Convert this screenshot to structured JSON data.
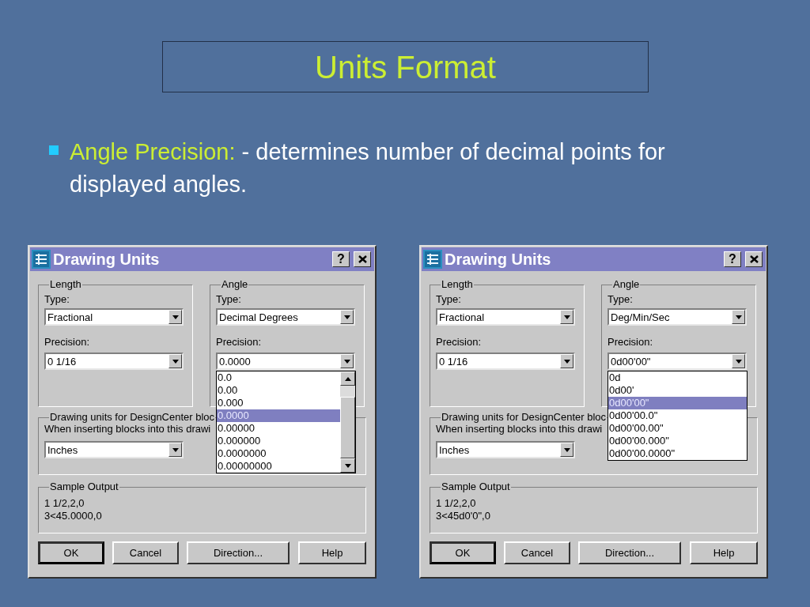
{
  "slide": {
    "title": "Units Format",
    "bullet": {
      "term": "Angle Precision:",
      "text": " - determines number of decimal points for displayed angles."
    }
  },
  "dialogs": [
    {
      "title": "Drawing Units",
      "help_button": "?",
      "length": {
        "label": "Length",
        "type_label": "Type:",
        "type": "Fractional",
        "precision_label": "Precision:",
        "precision": "0 1/16"
      },
      "angle": {
        "label": "Angle",
        "type_label": "Type:",
        "type": "Decimal Degrees",
        "precision_label": "Precision:",
        "precision": "0.0000",
        "dropdown": {
          "scrollbar": true,
          "options": [
            {
              "label": "0.0",
              "selected": false
            },
            {
              "label": "0.00",
              "selected": false
            },
            {
              "label": "0.000",
              "selected": false
            },
            {
              "label": "0.0000",
              "selected": true
            },
            {
              "label": "0.00000",
              "selected": false
            },
            {
              "label": "0.000000",
              "selected": false
            },
            {
              "label": "0.0000000",
              "selected": false
            },
            {
              "label": "0.00000000",
              "selected": false
            }
          ]
        }
      },
      "insert": {
        "label": "Drawing units for DesignCenter bloc",
        "prompt": "When inserting blocks into this drawi",
        "units": "Inches"
      },
      "sample": {
        "label": "Sample Output",
        "lines": [
          "1 1/2,2,0",
          "3<45.0000,0"
        ]
      },
      "buttons": [
        {
          "label": "OK",
          "default": true
        },
        {
          "label": "Cancel",
          "default": false
        },
        {
          "label": "Direction...",
          "default": false
        },
        {
          "label": "Help",
          "default": false
        }
      ]
    },
    {
      "title": "Drawing Units",
      "help_button": "?",
      "length": {
        "label": "Length",
        "type_label": "Type:",
        "type": "Fractional",
        "precision_label": "Precision:",
        "precision": "0 1/16"
      },
      "angle": {
        "label": "Angle",
        "type_label": "Type:",
        "type": "Deg/Min/Sec",
        "precision_label": "Precision:",
        "precision": "0d00'00\"",
        "dropdown": {
          "scrollbar": false,
          "options": [
            {
              "label": "0d",
              "selected": false
            },
            {
              "label": "0d00'",
              "selected": false
            },
            {
              "label": "0d00'00\"",
              "selected": true
            },
            {
              "label": "0d00'00.0\"",
              "selected": false
            },
            {
              "label": "0d00'00.00\"",
              "selected": false
            },
            {
              "label": "0d00'00.000\"",
              "selected": false
            },
            {
              "label": "0d00'00.0000\"",
              "selected": false
            }
          ]
        }
      },
      "insert": {
        "label": "Drawing units for DesignCenter bloc",
        "prompt": "When inserting blocks into this drawi",
        "units": "Inches"
      },
      "sample": {
        "label": "Sample Output",
        "lines": [
          "1 1/2,2,0",
          "3<45d0'0\",0"
        ]
      },
      "buttons": [
        {
          "label": "OK",
          "default": true
        },
        {
          "label": "Cancel",
          "default": false
        },
        {
          "label": "Direction...",
          "default": false
        },
        {
          "label": "Help",
          "default": false
        }
      ]
    }
  ]
}
